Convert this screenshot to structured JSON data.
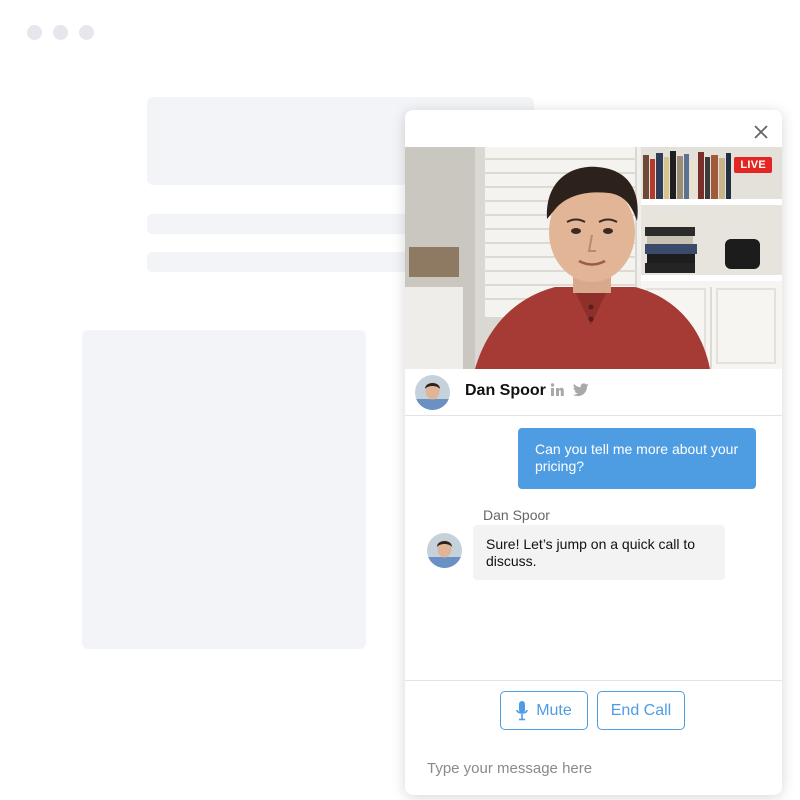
{
  "widget": {
    "video": {
      "live_badge": "LIVE"
    },
    "profile": {
      "name": "Dan Spoor",
      "social_icons": [
        "linkedin-icon",
        "twitter-icon"
      ]
    },
    "messages": {
      "user_message": "Can you tell me more about your pricing?",
      "agent_name": "Dan Spoor",
      "agent_message": "Sure! Let’s jump on a quick call to discuss."
    },
    "controls": {
      "mute_label": "Mute",
      "end_call_label": "End Call"
    },
    "input": {
      "placeholder": "Type your message here"
    }
  },
  "colors": {
    "accent": "#4e9de3",
    "live_red": "#e52521",
    "placeholder_gray": "#f3f4f7"
  }
}
